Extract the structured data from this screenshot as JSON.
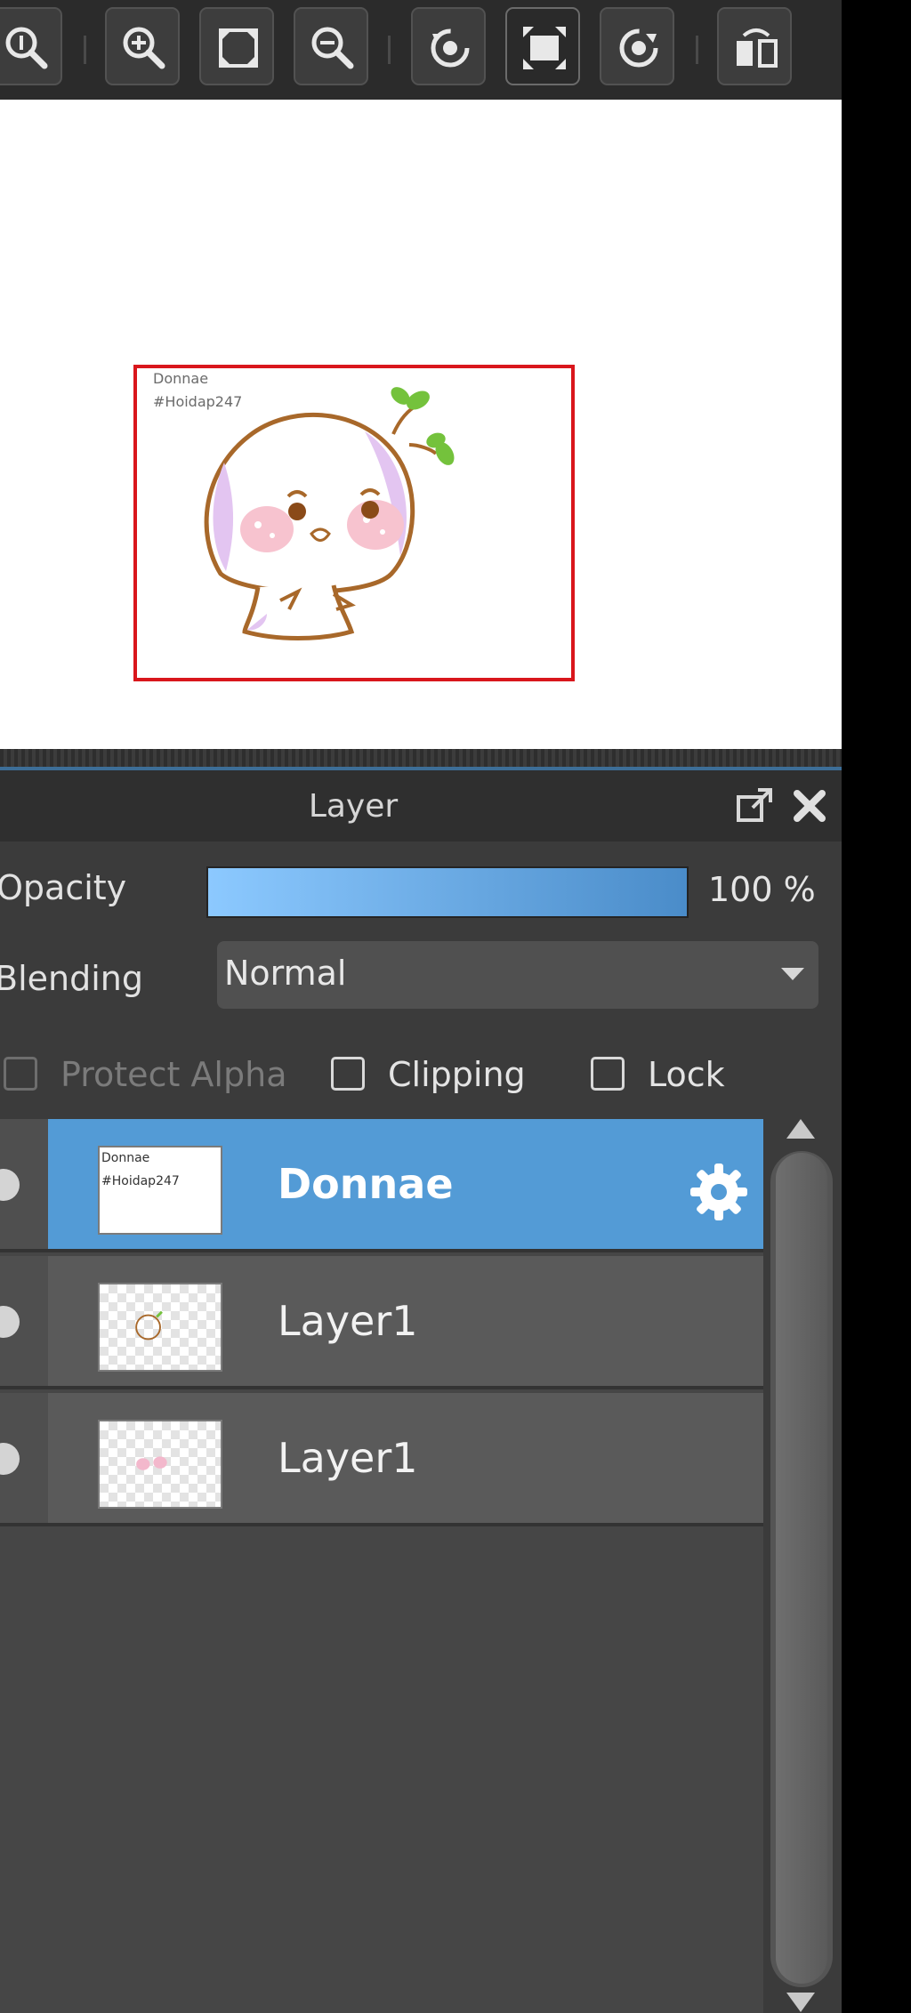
{
  "toolbar": {
    "buttons": [
      {
        "icon": "zoom-actual-icon"
      },
      {
        "icon": "zoom-in-icon"
      },
      {
        "icon": "fit-screen-icon"
      },
      {
        "icon": "zoom-out-icon"
      },
      {
        "icon": "rotate-left-icon"
      },
      {
        "icon": "fit-canvas-icon",
        "active": true
      },
      {
        "icon": "rotate-right-icon"
      },
      {
        "icon": "flip-horizontal-icon"
      }
    ]
  },
  "canvas": {
    "artboard_text_line1": "Donnae",
    "artboard_text_line2": "#Hoidap247"
  },
  "panel": {
    "title": "Layer",
    "opacity_label": "Opacity",
    "opacity_value": "100 %",
    "opacity_level": 1.0,
    "blending_label": "Blending",
    "blending_value": "Normal",
    "protect_alpha_label": "Protect Alpha",
    "clipping_label": "Clipping",
    "lock_label": "Lock",
    "layers": [
      {
        "name": "Donnae",
        "selected": true
      },
      {
        "name": "Layer1",
        "selected": false
      },
      {
        "name": "Layer1",
        "selected": false
      }
    ]
  },
  "colors": {
    "accent_selected": "#539bd6",
    "artboard_border": "#d9161c"
  }
}
